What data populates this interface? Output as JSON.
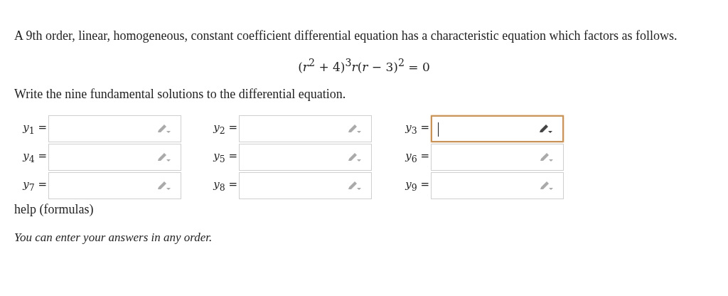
{
  "intro": "A 9th order, linear, homogeneous, constant coefficient differential equation has a characteristic equation which factors as follows.",
  "equation": "(*r*$^{2}$ + 4)$^{3}$*r*(*r* − 3)$^{2}$ = 0",
  "prompt": "Write the nine fundamental solutions to the differential equation.",
  "answers": [
    {
      "label": "*y*$_{1}$ =",
      "focused": false
    },
    {
      "label": "*y*$_{2}$ =",
      "focused": false
    },
    {
      "label": "*y*$_{3}$ =",
      "focused": true
    },
    {
      "label": "*y*$_{4}$ =",
      "focused": false
    },
    {
      "label": "*y*$_{5}$ =",
      "focused": false
    },
    {
      "label": "*y*$_{6}$ =",
      "focused": false
    },
    {
      "label": "*y*$_{7}$ =",
      "focused": false
    },
    {
      "label": "*y*$_{8}$ =",
      "focused": false
    },
    {
      "label": "*y*$_{9}$ =",
      "focused": false
    }
  ],
  "help_link": "help (formulas)",
  "note": "You can enter your answers in any order."
}
